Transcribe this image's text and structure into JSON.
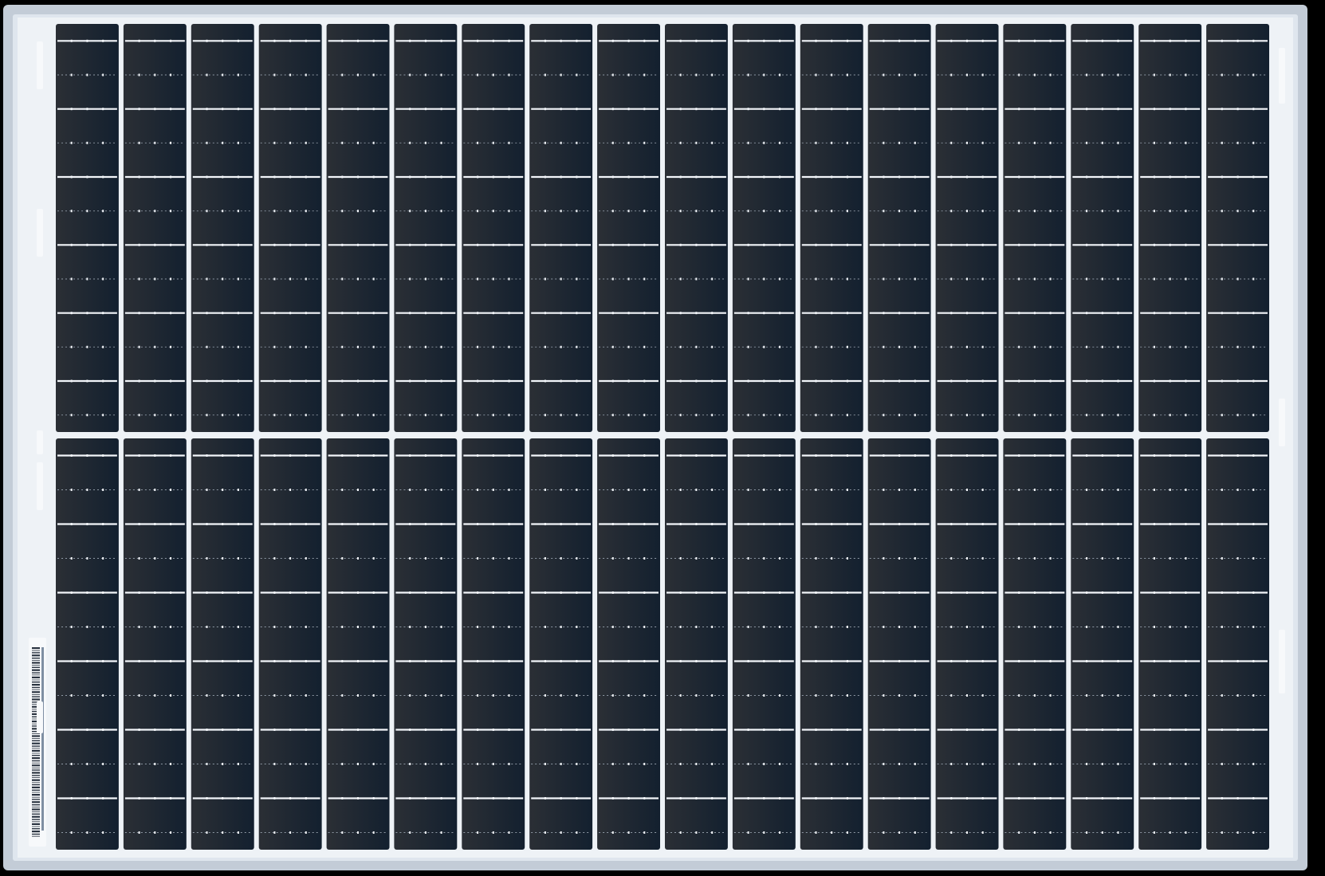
{
  "panel": {
    "columns": 18,
    "rows_per_half": 12,
    "halves": 2,
    "busbar_ticks_per_row": 3
  },
  "colors": {
    "background": "#000000",
    "frame": "#dfe6ee",
    "frame_shadow": "#c3ccd7",
    "backsheet": "#eef2f6",
    "cell_left": "#2b2f35",
    "cell_right": "#13202f",
    "ribbon": "#f3f6fa",
    "finger": "#8e98a4",
    "label": "#f7f9fb"
  },
  "label": {
    "icon": "barcode-label-icon"
  }
}
